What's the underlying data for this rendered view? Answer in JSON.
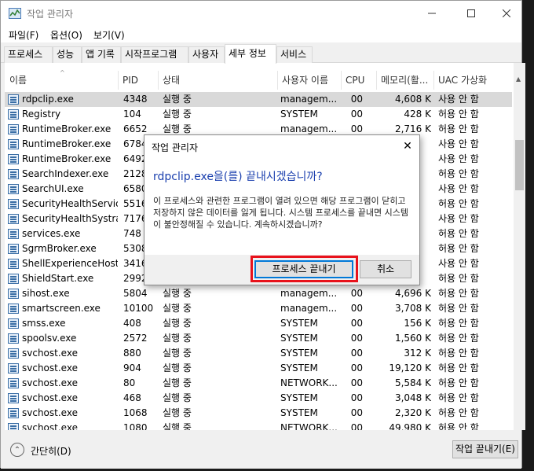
{
  "window": {
    "title": "작업 관리자",
    "menu": [
      "파일(F)",
      "옵션(O)",
      "보기(V)"
    ],
    "tabs": [
      "프로세스",
      "성능",
      "앱 기록",
      "시작프로그램",
      "사용자",
      "세부 정보",
      "서비스"
    ],
    "active_tab": "세부 정보"
  },
  "table": {
    "columns": [
      "이름",
      "PID",
      "상태",
      "사용자 이름",
      "CPU",
      "메모리(활...",
      "UAC 가상화"
    ],
    "rows": [
      {
        "name": "rdpclip.exe",
        "pid": "4348",
        "status": "실행 중",
        "user": "managem...",
        "cpu": "00",
        "mem": "4,608 K",
        "uac": "사용 안 함",
        "selected": true
      },
      {
        "name": "Registry",
        "pid": "104",
        "status": "실행 중",
        "user": "SYSTEM",
        "cpu": "00",
        "mem": "428 K",
        "uac": "허용 안 함"
      },
      {
        "name": "RuntimeBroker.exe",
        "pid": "6652",
        "status": "실행 중",
        "user": "managem...",
        "cpu": "00",
        "mem": "2,716 K",
        "uac": "허용 안 함"
      },
      {
        "name": "RuntimeBroker.exe",
        "pid": "6784",
        "status": "",
        "user": "",
        "cpu": "",
        "mem": "",
        "uac": "사용 안 함"
      },
      {
        "name": "RuntimeBroker.exe",
        "pid": "6492",
        "status": "",
        "user": "",
        "cpu": "",
        "mem": "",
        "uac": "사용 안 함"
      },
      {
        "name": "SearchIndexer.exe",
        "pid": "2128",
        "status": "",
        "user": "",
        "cpu": "",
        "mem": "",
        "uac": "허용 안 함"
      },
      {
        "name": "SearchUI.exe",
        "pid": "6580",
        "status": "",
        "user": "",
        "cpu": "",
        "mem": "",
        "uac": "사용 안 함"
      },
      {
        "name": "SecurityHealthServic...",
        "pid": "5516",
        "status": "",
        "user": "",
        "cpu": "",
        "mem": "",
        "uac": "허용 안 함"
      },
      {
        "name": "SecurityHealthSystra...",
        "pid": "7176",
        "status": "",
        "user": "",
        "cpu": "",
        "mem": "",
        "uac": "사용 안 함"
      },
      {
        "name": "services.exe",
        "pid": "748",
        "status": "",
        "user": "",
        "cpu": "",
        "mem": "",
        "uac": "허용 안 함"
      },
      {
        "name": "SgrmBroker.exe",
        "pid": "5308",
        "status": "",
        "user": "",
        "cpu": "",
        "mem": "",
        "uac": "허용 안 함"
      },
      {
        "name": "ShellExperienceHost...",
        "pid": "3416",
        "status": "",
        "user": "",
        "cpu": "",
        "mem": "",
        "uac": "사용 안 함"
      },
      {
        "name": "ShieldStart.exe",
        "pid": "2992",
        "status": "",
        "user": "",
        "cpu": "",
        "mem": "",
        "uac": "허용 안 함"
      },
      {
        "name": "sihost.exe",
        "pid": "5804",
        "status": "실행 중",
        "user": "managem...",
        "cpu": "00",
        "mem": "4,696 K",
        "uac": "허용 안 함"
      },
      {
        "name": "smartscreen.exe",
        "pid": "10100",
        "status": "실행 중",
        "user": "managem...",
        "cpu": "00",
        "mem": "3,708 K",
        "uac": "허용 안 함"
      },
      {
        "name": "smss.exe",
        "pid": "408",
        "status": "실행 중",
        "user": "SYSTEM",
        "cpu": "00",
        "mem": "156 K",
        "uac": "허용 안 함"
      },
      {
        "name": "spoolsv.exe",
        "pid": "2572",
        "status": "실행 중",
        "user": "SYSTEM",
        "cpu": "00",
        "mem": "1,560 K",
        "uac": "허용 안 함"
      },
      {
        "name": "svchost.exe",
        "pid": "880",
        "status": "실행 중",
        "user": "SYSTEM",
        "cpu": "00",
        "mem": "312 K",
        "uac": "허용 안 함"
      },
      {
        "name": "svchost.exe",
        "pid": "904",
        "status": "실행 중",
        "user": "SYSTEM",
        "cpu": "00",
        "mem": "19,120 K",
        "uac": "허용 안 함"
      },
      {
        "name": "svchost.exe",
        "pid": "80",
        "status": "실행 중",
        "user": "NETWORK...",
        "cpu": "00",
        "mem": "5,584 K",
        "uac": "허용 안 함"
      },
      {
        "name": "svchost.exe",
        "pid": "468",
        "status": "실행 중",
        "user": "SYSTEM",
        "cpu": "00",
        "mem": "3,048 K",
        "uac": "허용 안 함"
      },
      {
        "name": "svchost.exe",
        "pid": "1068",
        "status": "실행 중",
        "user": "SYSTEM",
        "cpu": "00",
        "mem": "2,320 K",
        "uac": "허용 안 함"
      },
      {
        "name": "svchost.exe",
        "pid": "1080",
        "status": "실행 중",
        "user": "NETWORK...",
        "cpu": "00",
        "mem": "49,980 K",
        "uac": "허용 안 함"
      }
    ]
  },
  "footer": {
    "fewer_details": "간단히(D)",
    "end_task": "작업 끝내기(E)"
  },
  "dialog": {
    "title": "작업 관리자",
    "heading": "rdpclip.exe을(를) 끝내시겠습니까?",
    "body": "이 프로세스와 관련한 프로그램이 열려 있으면 해당 프로그램이 닫히고 저장하지 않은 데이터를 잃게 됩니다. 시스템 프로세스를 끝내면 시스템이 불안정해질 수 있습니다. 계속하시겠습니까?",
    "confirm_label": "프로세스 끝내기",
    "cancel_label": "취소"
  },
  "colors": {
    "highlight": "#e8121b",
    "accent": "#0078d7",
    "heading": "#1a3fae"
  }
}
